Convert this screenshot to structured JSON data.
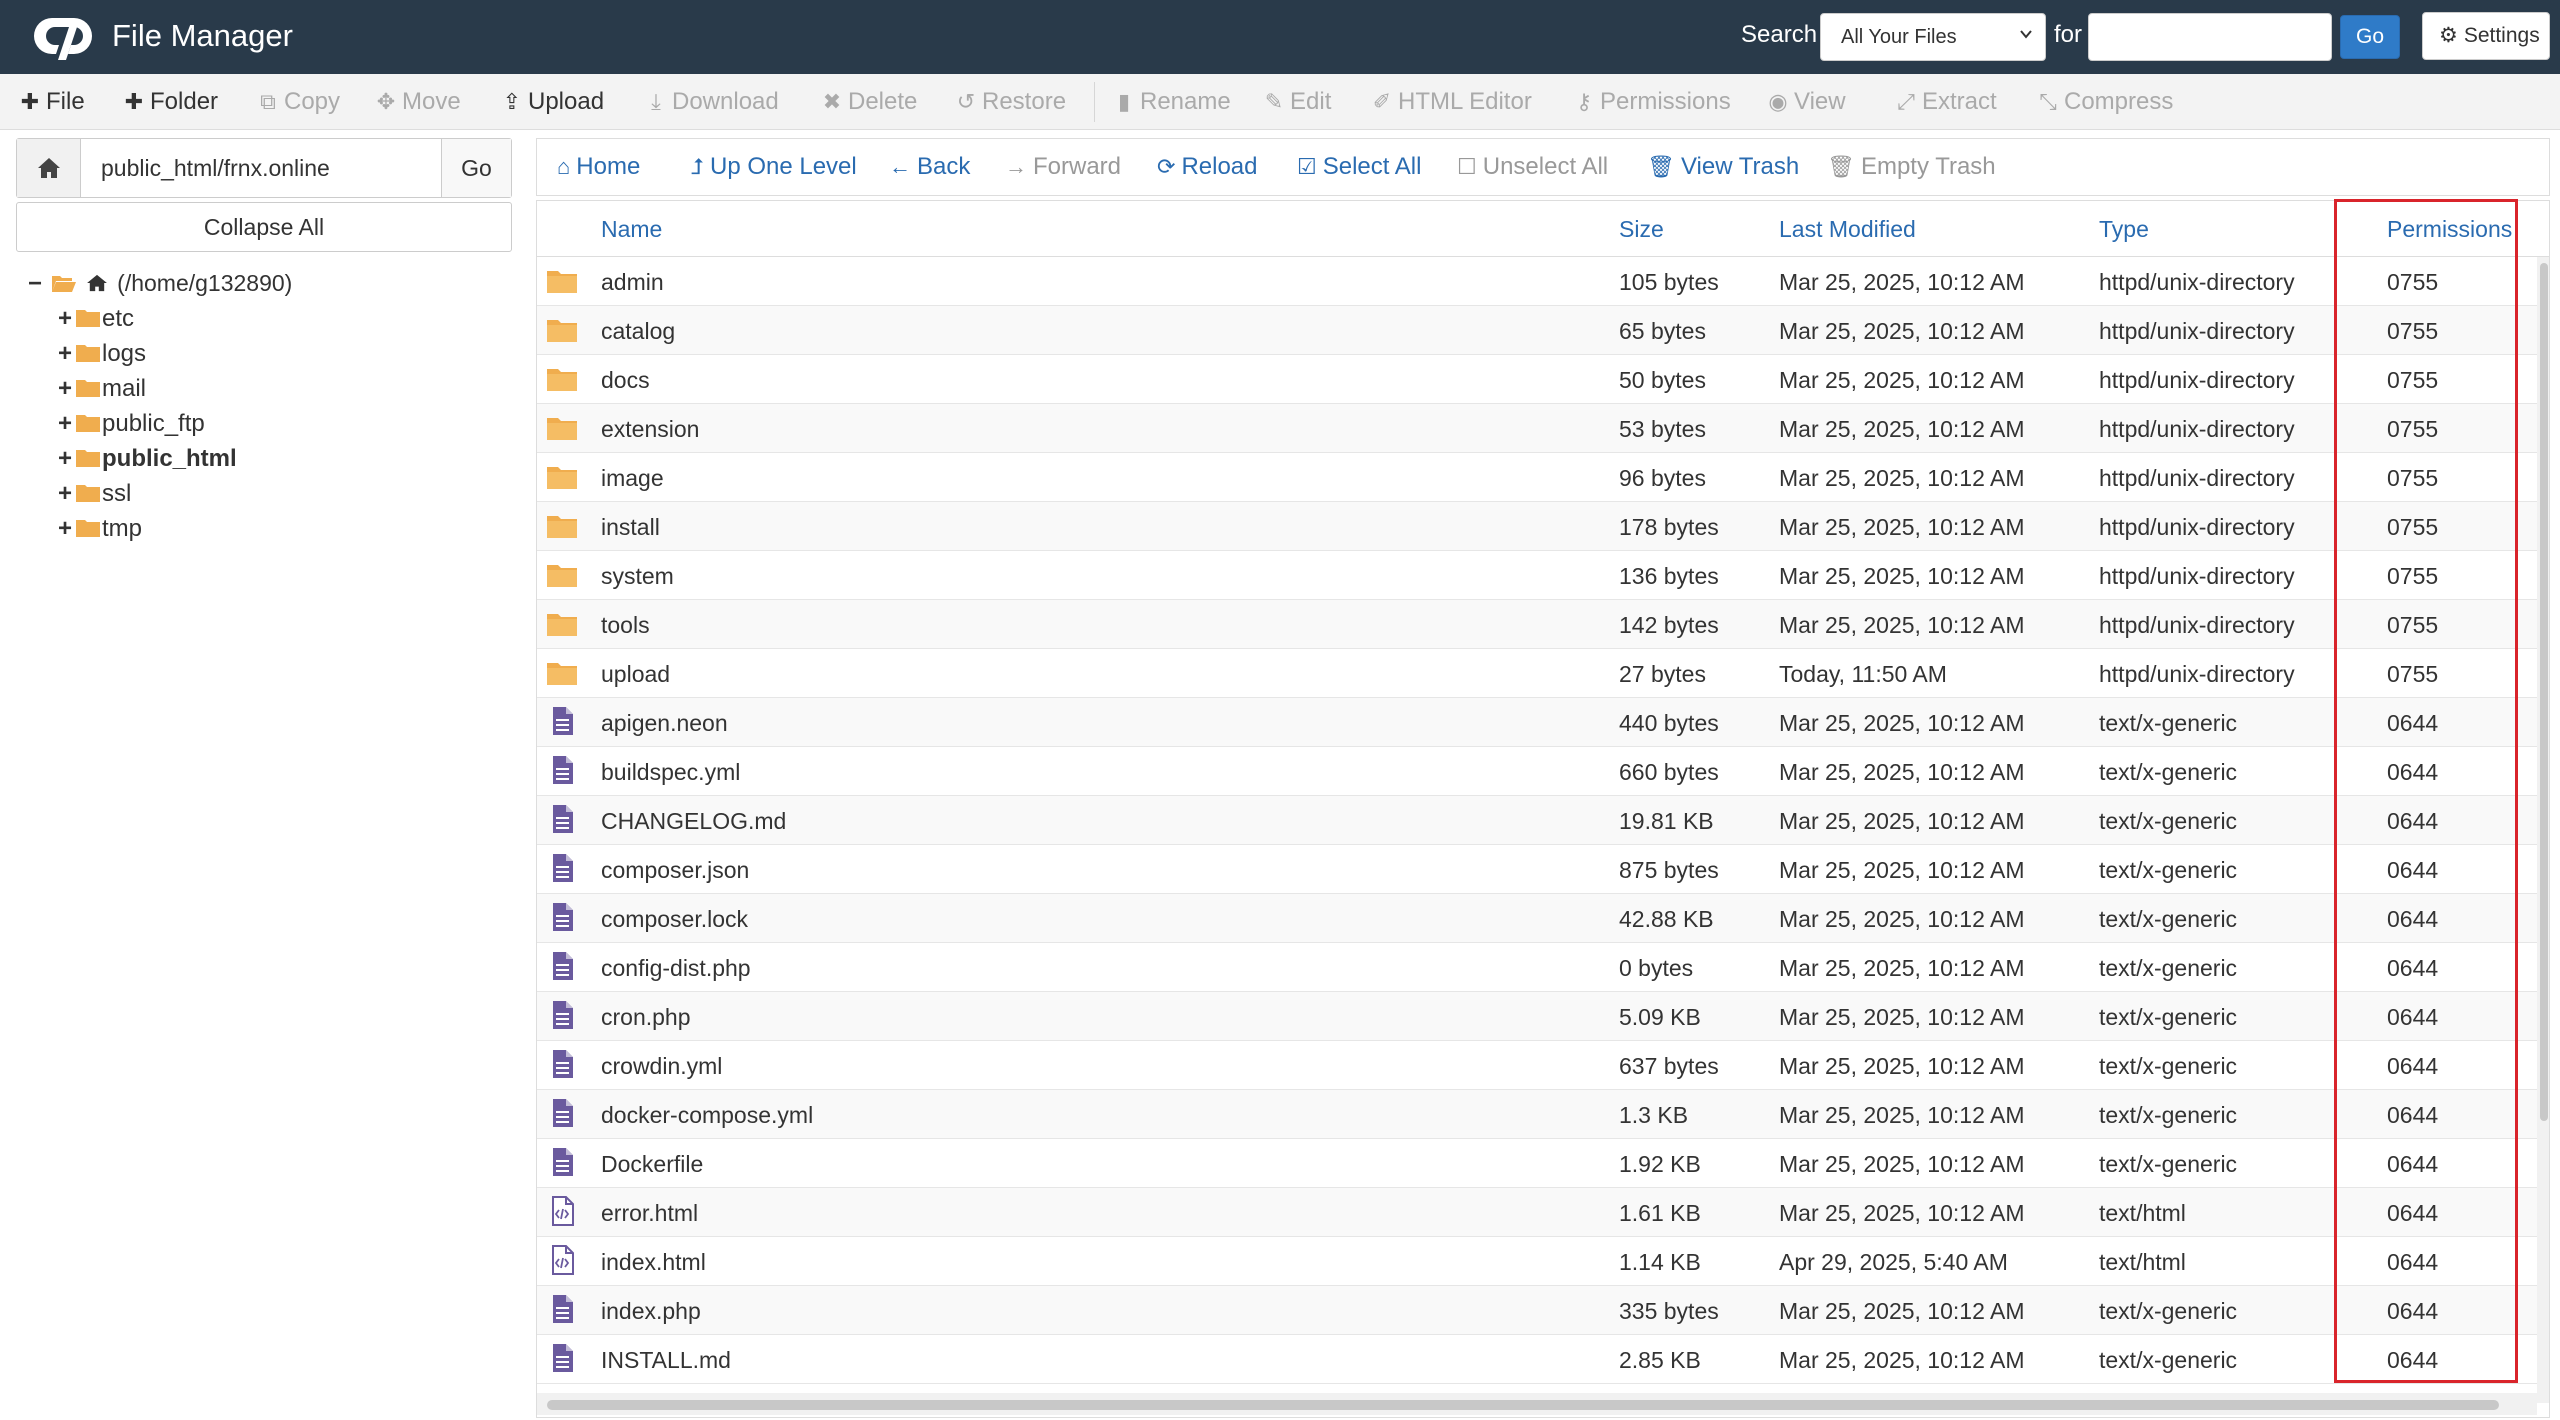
{
  "header": {
    "app_title": "File Manager",
    "search_label": "Search",
    "search_scope": "All Your Files",
    "for_label": "for",
    "search_value": "",
    "go_label": "Go",
    "settings_label": "Settings"
  },
  "toolbar": {
    "file": "File",
    "folder": "Folder",
    "copy": "Copy",
    "move": "Move",
    "upload": "Upload",
    "download": "Download",
    "delete": "Delete",
    "restore": "Restore",
    "rename": "Rename",
    "edit": "Edit",
    "html_editor": "HTML Editor",
    "permissions": "Permissions",
    "view": "View",
    "extract": "Extract",
    "compress": "Compress"
  },
  "sidebar": {
    "path_value": "public_html/frnx.online",
    "go_label": "Go",
    "collapse_all": "Collapse All",
    "root": "(/home/g132890)",
    "items": [
      {
        "label": "etc",
        "bold": false
      },
      {
        "label": "logs",
        "bold": false
      },
      {
        "label": "mail",
        "bold": false
      },
      {
        "label": "public_ftp",
        "bold": false
      },
      {
        "label": "public_html",
        "bold": true
      },
      {
        "label": "ssl",
        "bold": false
      },
      {
        "label": "tmp",
        "bold": false
      }
    ]
  },
  "navbar": {
    "home": "Home",
    "up_one_level": "Up One Level",
    "back": "Back",
    "forward": "Forward",
    "reload": "Reload",
    "select_all": "Select All",
    "unselect_all": "Unselect All",
    "view_trash": "View Trash",
    "empty_trash": "Empty Trash"
  },
  "table": {
    "columns": {
      "name": "Name",
      "size": "Size",
      "modified": "Last Modified",
      "type": "Type",
      "permissions": "Permissions"
    },
    "rows": [
      {
        "icon": "folder",
        "name": "admin",
        "size": "105 bytes",
        "modified": "Mar 25, 2025, 10:12 AM",
        "type": "httpd/unix-directory",
        "perms": "0755"
      },
      {
        "icon": "folder",
        "name": "catalog",
        "size": "65 bytes",
        "modified": "Mar 25, 2025, 10:12 AM",
        "type": "httpd/unix-directory",
        "perms": "0755"
      },
      {
        "icon": "folder",
        "name": "docs",
        "size": "50 bytes",
        "modified": "Mar 25, 2025, 10:12 AM",
        "type": "httpd/unix-directory",
        "perms": "0755"
      },
      {
        "icon": "folder",
        "name": "extension",
        "size": "53 bytes",
        "modified": "Mar 25, 2025, 10:12 AM",
        "type": "httpd/unix-directory",
        "perms": "0755"
      },
      {
        "icon": "folder",
        "name": "image",
        "size": "96 bytes",
        "modified": "Mar 25, 2025, 10:12 AM",
        "type": "httpd/unix-directory",
        "perms": "0755"
      },
      {
        "icon": "folder",
        "name": "install",
        "size": "178 bytes",
        "modified": "Mar 25, 2025, 10:12 AM",
        "type": "httpd/unix-directory",
        "perms": "0755"
      },
      {
        "icon": "folder",
        "name": "system",
        "size": "136 bytes",
        "modified": "Mar 25, 2025, 10:12 AM",
        "type": "httpd/unix-directory",
        "perms": "0755"
      },
      {
        "icon": "folder",
        "name": "tools",
        "size": "142 bytes",
        "modified": "Mar 25, 2025, 10:12 AM",
        "type": "httpd/unix-directory",
        "perms": "0755"
      },
      {
        "icon": "folder",
        "name": "upload",
        "size": "27 bytes",
        "modified": "Today, 11:50 AM",
        "type": "httpd/unix-directory",
        "perms": "0755"
      },
      {
        "icon": "file",
        "name": "apigen.neon",
        "size": "440 bytes",
        "modified": "Mar 25, 2025, 10:12 AM",
        "type": "text/x-generic",
        "perms": "0644"
      },
      {
        "icon": "file",
        "name": "buildspec.yml",
        "size": "660 bytes",
        "modified": "Mar 25, 2025, 10:12 AM",
        "type": "text/x-generic",
        "perms": "0644"
      },
      {
        "icon": "file",
        "name": "CHANGELOG.md",
        "size": "19.81 KB",
        "modified": "Mar 25, 2025, 10:12 AM",
        "type": "text/x-generic",
        "perms": "0644"
      },
      {
        "icon": "file",
        "name": "composer.json",
        "size": "875 bytes",
        "modified": "Mar 25, 2025, 10:12 AM",
        "type": "text/x-generic",
        "perms": "0644"
      },
      {
        "icon": "file",
        "name": "composer.lock",
        "size": "42.88 KB",
        "modified": "Mar 25, 2025, 10:12 AM",
        "type": "text/x-generic",
        "perms": "0644"
      },
      {
        "icon": "file",
        "name": "config-dist.php",
        "size": "0 bytes",
        "modified": "Mar 25, 2025, 10:12 AM",
        "type": "text/x-generic",
        "perms": "0644"
      },
      {
        "icon": "file",
        "name": "cron.php",
        "size": "5.09 KB",
        "modified": "Mar 25, 2025, 10:12 AM",
        "type": "text/x-generic",
        "perms": "0644"
      },
      {
        "icon": "file",
        "name": "crowdin.yml",
        "size": "637 bytes",
        "modified": "Mar 25, 2025, 10:12 AM",
        "type": "text/x-generic",
        "perms": "0644"
      },
      {
        "icon": "file",
        "name": "docker-compose.yml",
        "size": "1.3 KB",
        "modified": "Mar 25, 2025, 10:12 AM",
        "type": "text/x-generic",
        "perms": "0644"
      },
      {
        "icon": "file",
        "name": "Dockerfile",
        "size": "1.92 KB",
        "modified": "Mar 25, 2025, 10:12 AM",
        "type": "text/x-generic",
        "perms": "0644"
      },
      {
        "icon": "html",
        "name": "error.html",
        "size": "1.61 KB",
        "modified": "Mar 25, 2025, 10:12 AM",
        "type": "text/html",
        "perms": "0644"
      },
      {
        "icon": "html",
        "name": "index.html",
        "size": "1.14 KB",
        "modified": "Apr 29, 2025, 5:40 AM",
        "type": "text/html",
        "perms": "0644"
      },
      {
        "icon": "file",
        "name": "index.php",
        "size": "335 bytes",
        "modified": "Mar 25, 2025, 10:12 AM",
        "type": "text/x-generic",
        "perms": "0644"
      },
      {
        "icon": "file",
        "name": "INSTALL.md",
        "size": "2.85 KB",
        "modified": "Mar 25, 2025, 10:12 AM",
        "type": "text/x-generic",
        "perms": "0644"
      }
    ]
  },
  "colors": {
    "header_bg": "#293a4a",
    "link_blue": "#2a6bb0",
    "folder_orange": "#f0ad4e",
    "file_purple": "#6a5a9e",
    "highlight_red": "#d9242b"
  }
}
